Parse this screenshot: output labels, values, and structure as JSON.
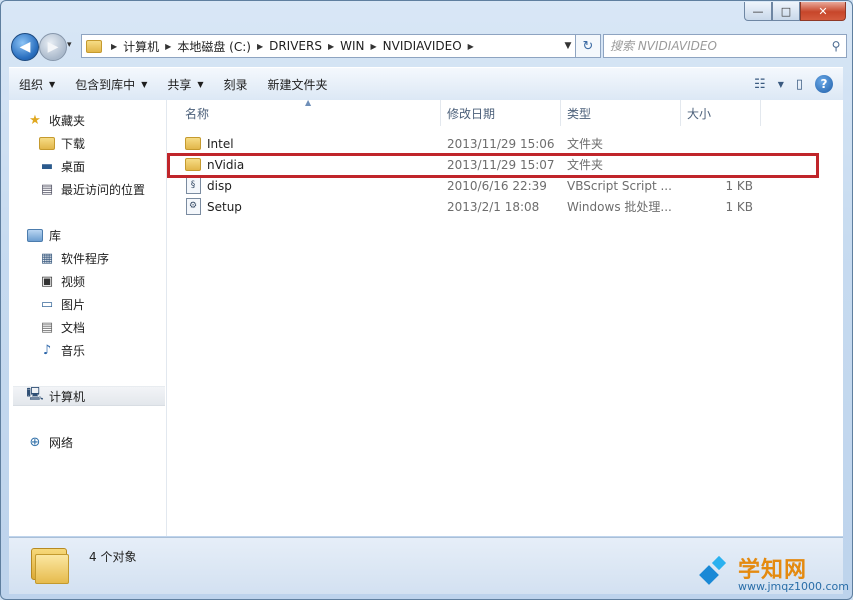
{
  "window": {
    "buttons": {
      "minimize": "—",
      "maximize": "□",
      "close": "✕"
    }
  },
  "nav": {
    "back": "◀",
    "forward": "▶",
    "history": "▾",
    "breadcrumbs": [
      "计算机",
      "本地磁盘 (C:)",
      "DRIVERS",
      "WIN",
      "NVIDIAVIDEO"
    ],
    "refresh": "↻",
    "search_placeholder": "搜索 NVIDIAVIDEO"
  },
  "toolbar": {
    "organize": "组织",
    "include_library": "包含到库中",
    "share": "共享",
    "burn": "刻录",
    "new_folder": "新建文件夹"
  },
  "sidebar": {
    "favorites": "收藏夹",
    "downloads": "下载",
    "desktop": "桌面",
    "recent": "最近访问的位置",
    "libraries": "库",
    "software": "软件程序",
    "videos": "视频",
    "pictures": "图片",
    "documents": "文档",
    "music": "音乐",
    "computer": "计算机",
    "network": "网络"
  },
  "columns": {
    "name": "名称",
    "date": "修改日期",
    "type": "类型",
    "size": "大小"
  },
  "files": [
    {
      "name": "Intel",
      "date": "2013/11/29 15:06",
      "type": "文件夹",
      "size": "",
      "icon": "folder-icon"
    },
    {
      "name": "nVidia",
      "date": "2013/11/29 15:07",
      "type": "文件夹",
      "size": "",
      "icon": "folder-icon"
    },
    {
      "name": "disp",
      "date": "2010/6/16 22:39",
      "type": "VBScript Script ...",
      "size": "1 KB",
      "icon": "vbscript-icon"
    },
    {
      "name": "Setup",
      "date": "2013/2/1 18:08",
      "type": "Windows 批处理...",
      "size": "1 KB",
      "icon": "batch-icon"
    }
  ],
  "status": {
    "count": "4 个对象"
  },
  "watermark": {
    "title": "学知网",
    "sub": "www.jmqz1000.com"
  },
  "colors": {
    "highlight": "#c0252a",
    "folder": "#e2b64a",
    "accent": "#2a6fbf"
  }
}
